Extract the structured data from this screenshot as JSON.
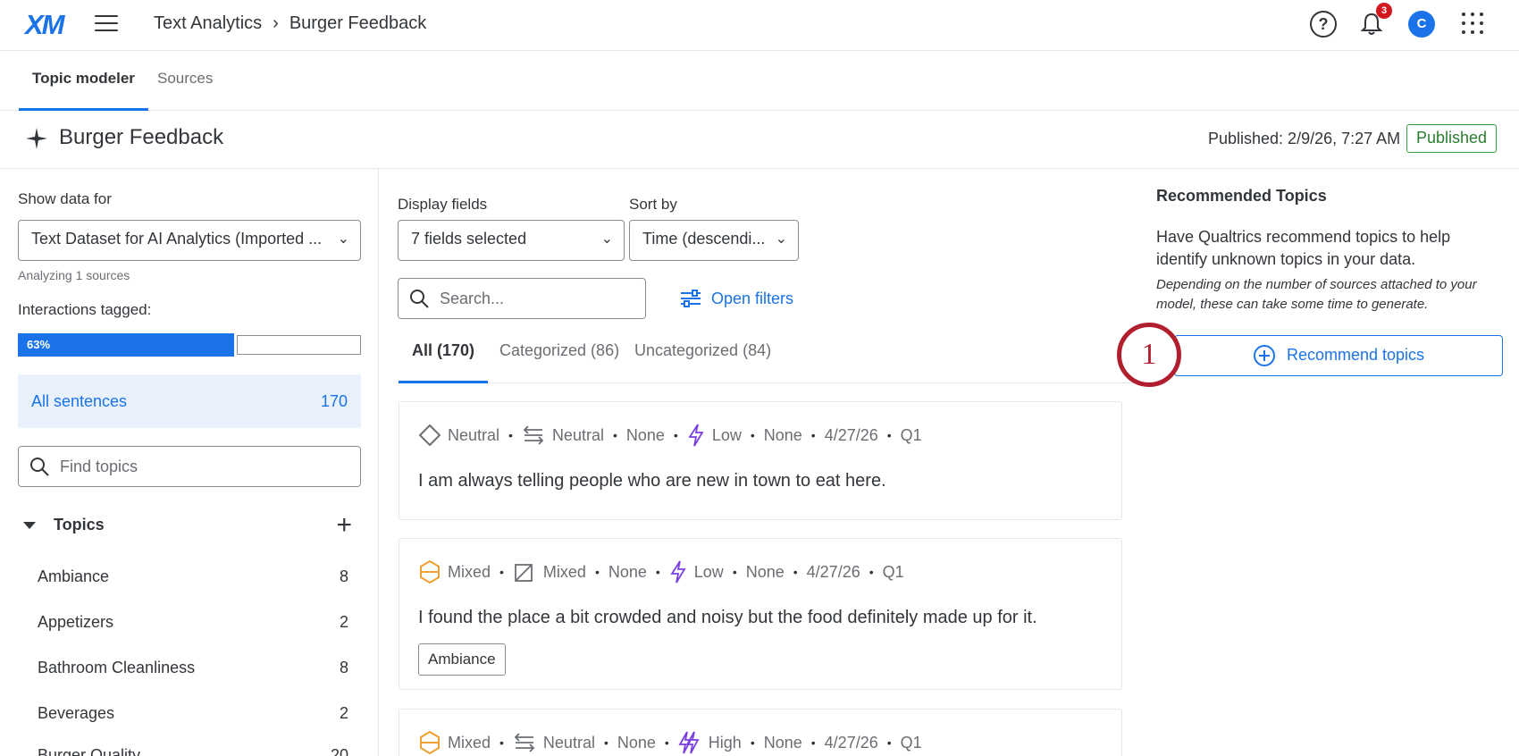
{
  "topbar": {
    "logo": "XM",
    "breadcrumb": [
      "Text Analytics",
      "Burger Feedback"
    ],
    "notification_count": "3",
    "avatar_initial": "C",
    "help_glyph": "?"
  },
  "tabs": [
    {
      "label": "Topic modeler",
      "active": true
    },
    {
      "label": "Sources",
      "active": false
    }
  ],
  "page": {
    "title": "Burger Feedback",
    "published_time": "Published: 2/9/26, 7:27 AM",
    "status": "Published"
  },
  "sidebar": {
    "show_data_label": "Show data for",
    "dataset_value": "Text Dataset for AI Analytics (Imported ...",
    "analyzing_note": "Analyzing 1 sources",
    "interactions_label": "Interactions tagged:",
    "tagged_percent_label": "63%",
    "tagged_fraction": 0.63,
    "all_sentences_label": "All sentences",
    "all_sentences_count": "170",
    "find_topics_placeholder": "Find topics",
    "topics_header": "Topics",
    "topics": [
      {
        "name": "Ambiance",
        "count": "8"
      },
      {
        "name": "Appetizers",
        "count": "2"
      },
      {
        "name": "Bathroom Cleanliness",
        "count": "8"
      },
      {
        "name": "Beverages",
        "count": "2"
      },
      {
        "name": "Burger Quality",
        "count": "20"
      }
    ]
  },
  "center": {
    "display_fields_label": "Display fields",
    "display_fields_value": "7 fields selected",
    "sort_by_label": "Sort by",
    "sort_by_value": "Time (descendi...",
    "search_placeholder": "Search...",
    "open_filters_label": "Open filters",
    "subtabs": [
      {
        "label": "All (170)",
        "active": true
      },
      {
        "label": "Categorized (86)",
        "active": false
      },
      {
        "label": "Uncategorized (84)",
        "active": false
      }
    ],
    "cards": [
      {
        "sentiment": "Neutral",
        "sentiment_icon": "diamond-icon",
        "polarity": "Neutral",
        "polarity_icon": "neutral-arrows-icon",
        "field3": "None",
        "effort": "Low",
        "effort_icon": "lightning-icon",
        "field5": "None",
        "date": "4/27/26",
        "quarter": "Q1",
        "text": "I am always telling people who are new in town to eat here.",
        "tags": []
      },
      {
        "sentiment": "Mixed",
        "sentiment_icon": "hexagon-icon",
        "polarity": "Mixed",
        "polarity_icon": "mixed-arrows-icon",
        "field3": "None",
        "effort": "Low",
        "effort_icon": "lightning-icon",
        "field5": "None",
        "date": "4/27/26",
        "quarter": "Q1",
        "text": "I found the place a bit crowded and noisy but the food definitely made up for it.",
        "tags": [
          "Ambiance"
        ]
      },
      {
        "sentiment": "Mixed",
        "sentiment_icon": "hexagon-icon",
        "polarity": "Neutral",
        "polarity_icon": "neutral-arrows-icon",
        "field3": "None",
        "effort": "High",
        "effort_icon": "high-lightning-icon",
        "field5": "None",
        "date": "4/27/26",
        "quarter": "Q1",
        "text": "",
        "tags": []
      }
    ]
  },
  "right_panel": {
    "title": "Recommended Topics",
    "description": "Have Qualtrics recommend topics to help identify unknown topics in your data.",
    "note": "Depending on the number of sources attached to your model, these can take some time to generate.",
    "button_label": "Recommend topics",
    "step_number": "1"
  },
  "colors": {
    "accent": "#1a73e8",
    "published_green": "#2a7d2e",
    "mixed_orange": "#f0a030",
    "effort_purple": "#7b3fe4",
    "annotation_red": "#b11f2e",
    "badge_red": "#d1181f"
  }
}
